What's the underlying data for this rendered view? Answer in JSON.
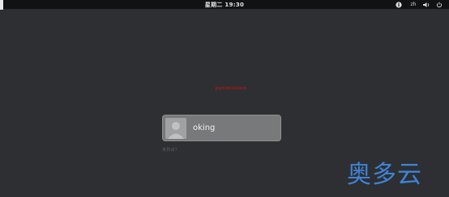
{
  "top_bar": {
    "clock": "星期二 19:30",
    "input_method": "zh"
  },
  "login": {
    "notice": "permission",
    "user": {
      "name": "oking"
    },
    "not_listed_link": "未列出？"
  },
  "watermark": "奥多云",
  "colors": {
    "background": "#2d2f33",
    "top_bar": "#111213",
    "user_card": "#77797b",
    "notice": "#9b1c1c",
    "watermark": "#3f83d6"
  }
}
